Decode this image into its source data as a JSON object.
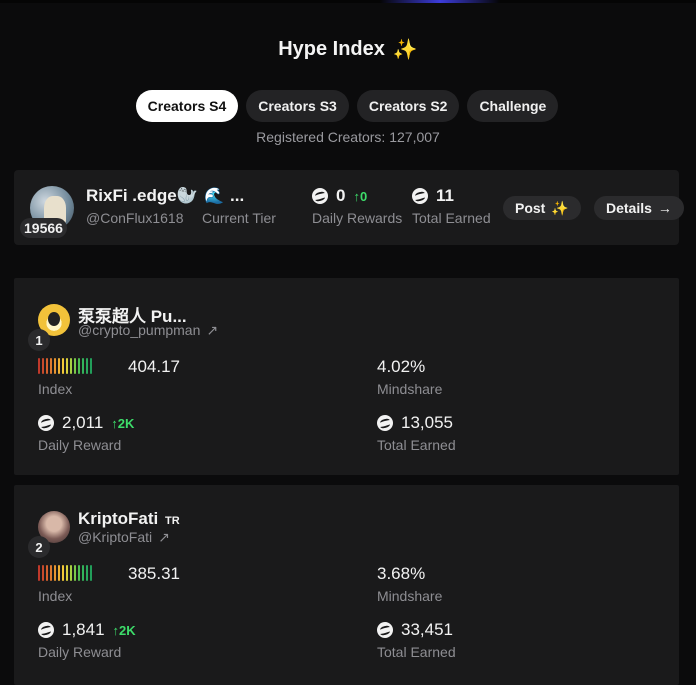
{
  "header": {
    "title": "Hype Index",
    "sparkle": "✨"
  },
  "tabs": [
    {
      "label": "Creators S4",
      "active": true
    },
    {
      "label": "Creators S3",
      "active": false
    },
    {
      "label": "Creators S2",
      "active": false
    },
    {
      "label": "Challenge",
      "active": false
    }
  ],
  "registered": "Registered Creators: 127,007",
  "user": {
    "rank": "19566",
    "name": "RixFi .edge🦭",
    "handle": "@ConFlux1618",
    "tier_icon": "🌊",
    "tier_value": "...",
    "tier_label": "Current Tier",
    "daily_value": "0",
    "daily_delta": "↑0",
    "daily_label": "Daily Rewards",
    "total_value": "11",
    "total_label": "Total Earned",
    "post_label": "Post",
    "post_icon": "✨",
    "details_label": "Details",
    "details_icon": "→"
  },
  "creators": [
    {
      "rank": "1",
      "name": "泵泵超人 Pu...",
      "tag": "",
      "handle": "@crypto_pumpman",
      "index_value": "404.17",
      "index_label": "Index",
      "mindshare_value": "4.02%",
      "mindshare_label": "Mindshare",
      "daily_value": "2,011",
      "daily_delta": "↑2K",
      "daily_label": "Daily Reward",
      "total_value": "13,055",
      "total_label": "Total Earned"
    },
    {
      "rank": "2",
      "name": "KriptoFati",
      "tag": "TR",
      "handle": "@KriptoFati",
      "index_value": "385.31",
      "index_label": "Index",
      "mindshare_value": "3.68%",
      "mindshare_label": "Mindshare",
      "daily_value": "1,841",
      "daily_delta": "↑2K",
      "daily_label": "Daily Reward",
      "total_value": "33,451",
      "total_label": "Total Earned"
    }
  ],
  "colors": {
    "background": "#0b0b0c",
    "card": "#1a1a1b",
    "positive": "#3ddc6a",
    "accent": "#b477ff"
  },
  "icons": [
    "sparkle-icon",
    "token-coin-icon",
    "arrow-up-right-icon",
    "arrow-right-icon",
    "wave-tier-icon"
  ]
}
